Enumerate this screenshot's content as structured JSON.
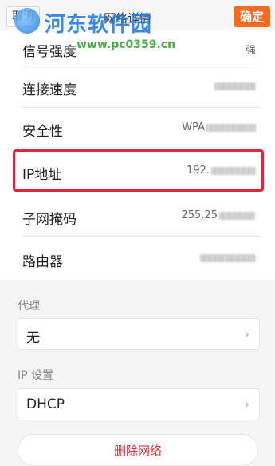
{
  "header": {
    "cancel_label": "取消",
    "title": "网络详情",
    "confirm_label": "确定"
  },
  "watermark": {
    "text": "河东软件园",
    "url": "www.pc0359.cn"
  },
  "details": [
    {
      "label": "信号强度",
      "value": "强"
    },
    {
      "label": "连接速度",
      "value": ""
    },
    {
      "label": "安全性",
      "value": "WPA"
    },
    {
      "label": "IP地址",
      "value": "192."
    },
    {
      "label": "子网掩码",
      "value": "255.25"
    },
    {
      "label": "路由器",
      "value": ""
    }
  ],
  "proxy": {
    "section_label": "代理",
    "selected": "无"
  },
  "ip_settings": {
    "section_label": "IP 设置",
    "selected": "DHCP"
  },
  "delete_button_label": "删除网络",
  "colors": {
    "accent": "#f36c21",
    "highlight": "#e02638",
    "danger_text": "#e0313b",
    "watermark_blue": "#1f7ae0",
    "watermark_green": "#3aa33a"
  }
}
